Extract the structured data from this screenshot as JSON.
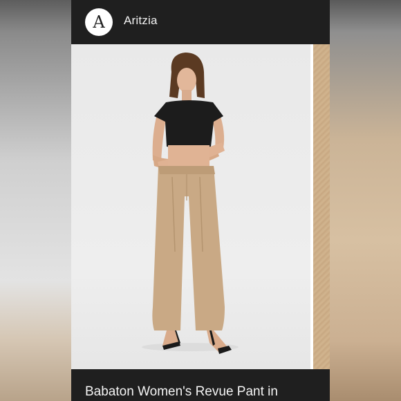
{
  "brand": {
    "logo_letter": "A",
    "name": "Aritzia"
  },
  "product": {
    "title": "Babaton Women's Revue Pant in"
  },
  "colors": {
    "topbar": "#1f1f1f",
    "photo_background": "#eeeeee",
    "pant_tan": "#c9a985",
    "top_black": "#1c1c1c"
  },
  "icons": {
    "logo": "aritzia-logo-icon"
  }
}
